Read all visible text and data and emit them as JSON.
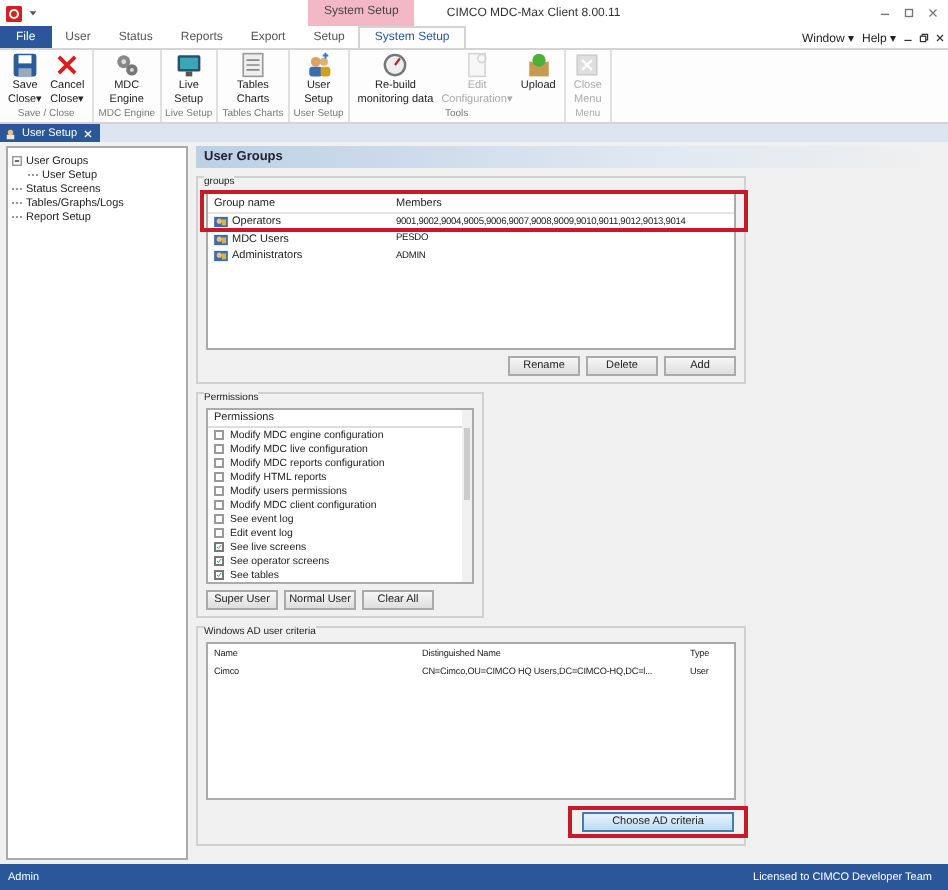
{
  "window": {
    "title": "CIMCO MDC-Max Client 8.00.11",
    "context_tab": "System Setup"
  },
  "menu_tabs": [
    {
      "label": "File",
      "kind": "file",
      "selected": false
    },
    {
      "label": "User",
      "kind": "tab",
      "selected": false
    },
    {
      "label": "Status",
      "kind": "tab",
      "selected": false
    },
    {
      "label": "Reports",
      "kind": "tab",
      "selected": false
    },
    {
      "label": "Export",
      "kind": "tab",
      "selected": false
    },
    {
      "label": "Setup",
      "kind": "tab",
      "selected": false
    },
    {
      "label": "System Setup",
      "kind": "tab",
      "selected": true
    }
  ],
  "window_menu": [
    "Window ▾",
    "Help ▾"
  ],
  "ribbon_groups": [
    {
      "name": "Save / Close",
      "buttons": [
        {
          "label": "Save\nClose▾",
          "disabled": false
        },
        {
          "label": "Cancel\nClose▾",
          "disabled": false
        }
      ]
    },
    {
      "name": "MDC Engine",
      "buttons": [
        {
          "label": "MDC\nEngine",
          "disabled": false
        }
      ]
    },
    {
      "name": "Live Setup",
      "buttons": [
        {
          "label": "Live\nSetup",
          "disabled": false
        }
      ]
    },
    {
      "name": "Tables Charts",
      "buttons": [
        {
          "label": "Tables\nCharts",
          "disabled": false
        }
      ]
    },
    {
      "name": "User Setup",
      "buttons": [
        {
          "label": "User\nSetup",
          "disabled": false
        }
      ]
    },
    {
      "name": "Tools",
      "buttons": [
        {
          "label": "Re-build\nmonitoring data",
          "disabled": false
        },
        {
          "label": "Edit\nConfiguration▾",
          "disabled": true
        },
        {
          "label": "Upload",
          "disabled": false
        }
      ]
    },
    {
      "name": "Menu",
      "disabled": true,
      "buttons": [
        {
          "label": "Close\nMenu",
          "disabled": true
        }
      ]
    }
  ],
  "document_tab": {
    "label": "User Setup"
  },
  "tree": [
    {
      "label": "User Groups",
      "expanded": true,
      "children": [
        {
          "label": "User Setup"
        }
      ]
    },
    {
      "label": "Status Screens"
    },
    {
      "label": "Tables/Graphs/Logs"
    },
    {
      "label": "Report Setup"
    }
  ],
  "panel_title": "User Groups",
  "user_groups": {
    "label": "groups",
    "highlighted": true,
    "columns": [
      "Group name",
      "Members"
    ],
    "rows": [
      {
        "name": "Operators",
        "members": "9001,9002,9004,9005,9006,9007,9008,9009,9010,9011,9012,9013,9014"
      },
      {
        "name": "MDC Users",
        "members": "PESDO"
      },
      {
        "name": "Administrators",
        "members": "ADMIN"
      }
    ],
    "buttons": [
      "Rename",
      "Delete",
      "Add"
    ]
  },
  "permissions": {
    "label": "Permissions",
    "header": "Permissions",
    "items": [
      {
        "label": "Modify MDC engine configuration",
        "checked": false
      },
      {
        "label": "Modify MDC live configuration",
        "checked": false
      },
      {
        "label": "Modify MDC reports configuration",
        "checked": false
      },
      {
        "label": "Modify HTML reports",
        "checked": false
      },
      {
        "label": "Modify users permissions",
        "checked": false
      },
      {
        "label": "Modify MDC client configuration",
        "checked": false
      },
      {
        "label": "See event log",
        "checked": false
      },
      {
        "label": "Edit event log",
        "checked": false
      },
      {
        "label": "See live screens",
        "checked": true
      },
      {
        "label": "See operator screens",
        "checked": true
      },
      {
        "label": "See tables",
        "checked": true
      }
    ],
    "buttons": [
      "Super User",
      "Normal User",
      "Clear All"
    ]
  },
  "ad_criteria": {
    "label": "Windows AD user criteria",
    "columns": [
      "Name",
      "Distinguished Name",
      "Type"
    ],
    "rows": [
      [
        "Cimco",
        "CN=Cimco,OU=CIMCO HQ Users,DC=CIMCO-HQ,DC=l...",
        "User"
      ]
    ],
    "button": "Choose AD criteria",
    "button_highlighted": true
  },
  "status_bar": {
    "user": "Admin",
    "license": "Licensed to CIMCO Developer Team"
  }
}
